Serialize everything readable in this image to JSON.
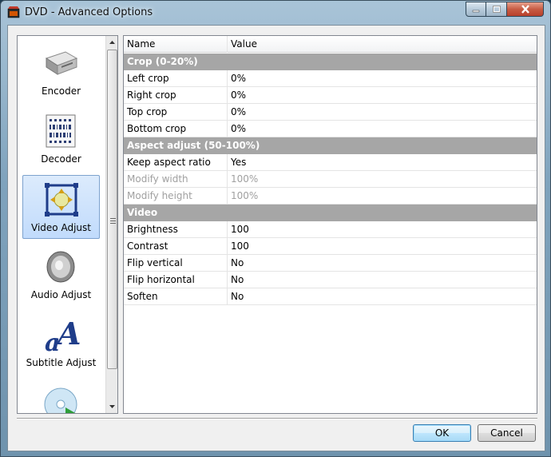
{
  "window": {
    "title": "DVD - Advanced Options"
  },
  "sidebar": {
    "items": [
      {
        "label": "Encoder",
        "icon": "encoder-icon"
      },
      {
        "label": "Decoder",
        "icon": "decoder-icon"
      },
      {
        "label": "Video Adjust",
        "icon": "video-adjust-icon",
        "selected": true
      },
      {
        "label": "Audio Adjust",
        "icon": "audio-adjust-icon"
      },
      {
        "label": "Subtitle Adjust",
        "icon": "subtitle-adjust-icon"
      },
      {
        "label": "",
        "icon": "disc-icon"
      }
    ]
  },
  "grid": {
    "header": {
      "name": "Name",
      "value": "Value"
    },
    "rows": [
      {
        "type": "category",
        "name": "Crop (0-20%)"
      },
      {
        "type": "property",
        "name": "Left crop",
        "value": "0%"
      },
      {
        "type": "property",
        "name": "Right crop",
        "value": "0%"
      },
      {
        "type": "property",
        "name": "Top crop",
        "value": "0%"
      },
      {
        "type": "property",
        "name": "Bottom crop",
        "value": "0%"
      },
      {
        "type": "category",
        "name": "Aspect adjust (50-100%)"
      },
      {
        "type": "property",
        "name": "Keep aspect ratio",
        "value": "Yes"
      },
      {
        "type": "property",
        "name": "Modify width",
        "value": "100%",
        "disabled": true
      },
      {
        "type": "property",
        "name": "Modify height",
        "value": "100%",
        "disabled": true
      },
      {
        "type": "category",
        "name": "Video"
      },
      {
        "type": "property",
        "name": "Brightness",
        "value": "100"
      },
      {
        "type": "property",
        "name": "Contrast",
        "value": "100"
      },
      {
        "type": "property",
        "name": "Flip vertical",
        "value": "No"
      },
      {
        "type": "property",
        "name": "Flip horizontal",
        "value": "No"
      },
      {
        "type": "property",
        "name": "Soften",
        "value": "No"
      }
    ]
  },
  "buttons": {
    "ok": "OK",
    "cancel": "Cancel"
  },
  "colors": {
    "category_bg": "#a6a6a6",
    "selection_bg": "#c1dbfc",
    "disabled_text": "#a0a0a0"
  }
}
